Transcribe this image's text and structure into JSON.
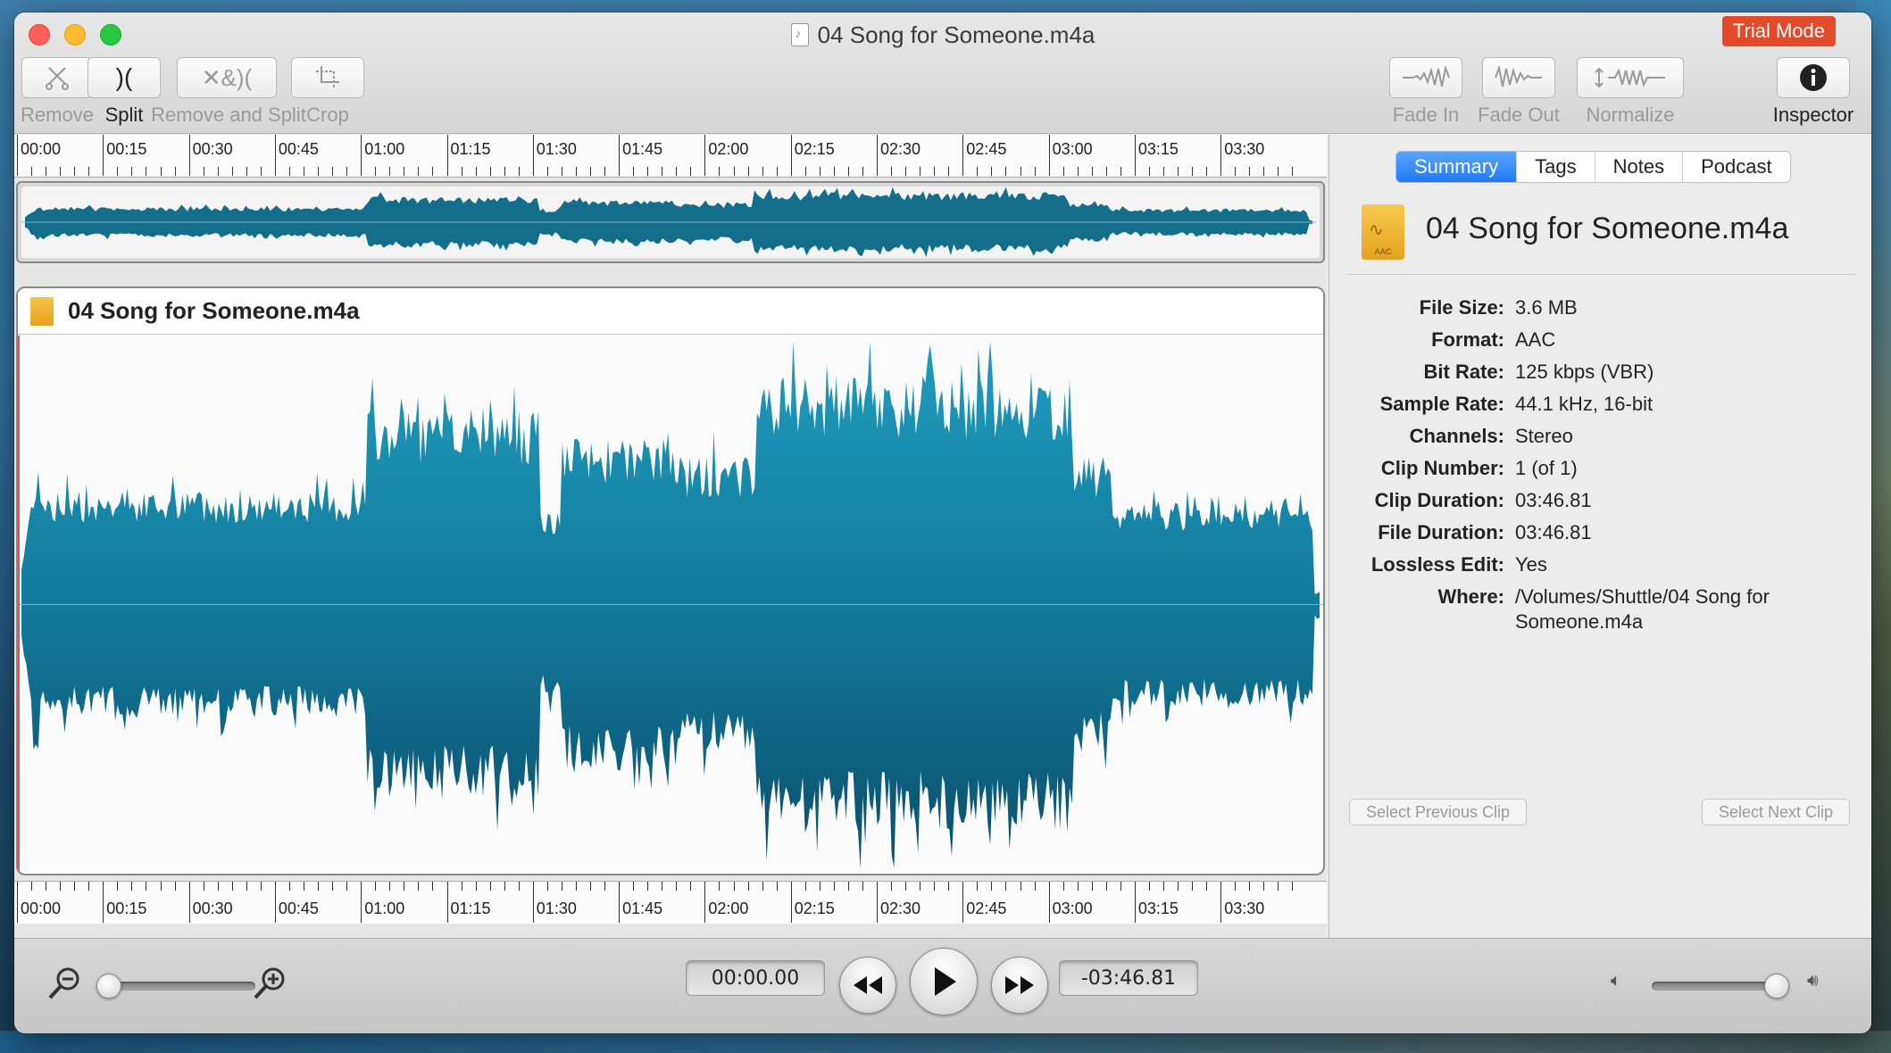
{
  "window": {
    "title": "04 Song for Someone.m4a",
    "trial_badge": "Trial Mode"
  },
  "toolbar": {
    "remove": "Remove",
    "split": "Split",
    "remove_and_split": "Remove and Split",
    "crop": "Crop",
    "fade_in": "Fade In",
    "fade_out": "Fade Out",
    "normalize": "Normalize",
    "inspector": "Inspector"
  },
  "ruler": {
    "labels": [
      "00:00",
      "00:15",
      "00:30",
      "00:45",
      "01:00",
      "01:15",
      "01:30",
      "01:45",
      "02:00",
      "02:15",
      "02:30",
      "02:45",
      "03:00",
      "03:15",
      "03:30"
    ]
  },
  "clip": {
    "title": "04 Song for Someone.m4a"
  },
  "inspector": {
    "tabs": [
      "Summary",
      "Tags",
      "Notes",
      "Podcast"
    ],
    "active_tab": "Summary",
    "file_name": "04 Song for Someone.m4a",
    "file_icon_label": "AAC",
    "properties": [
      {
        "key": "File Size:",
        "value": "3.6 MB"
      },
      {
        "key": "Format:",
        "value": "AAC"
      },
      {
        "key": "Bit Rate:",
        "value": "125 kbps (VBR)"
      },
      {
        "key": "Sample Rate:",
        "value": "44.1 kHz, 16-bit"
      },
      {
        "key": "Channels:",
        "value": "Stereo"
      },
      {
        "key": "Clip Number:",
        "value": "1 (of 1)"
      },
      {
        "key": "Clip Duration:",
        "value": "03:46.81"
      },
      {
        "key": "File Duration:",
        "value": "03:46.81"
      },
      {
        "key": "Lossless Edit:",
        "value": "Yes"
      },
      {
        "key": "Where:",
        "value": "/Volumes/Shuttle/04 Song for Someone.m4a"
      }
    ],
    "prev_clip": "Select Previous Clip",
    "next_clip": "Select Next Clip"
  },
  "transport": {
    "elapsed": "00:00.00",
    "remaining": "-03:46.81",
    "zoom_level": 0.0,
    "volume_level": 1.0
  },
  "colors": {
    "wave_top": "#1c93b4",
    "wave_bottom": "#0d5a78",
    "accent": "#1f7bf2",
    "trial": "#e24a2a"
  }
}
